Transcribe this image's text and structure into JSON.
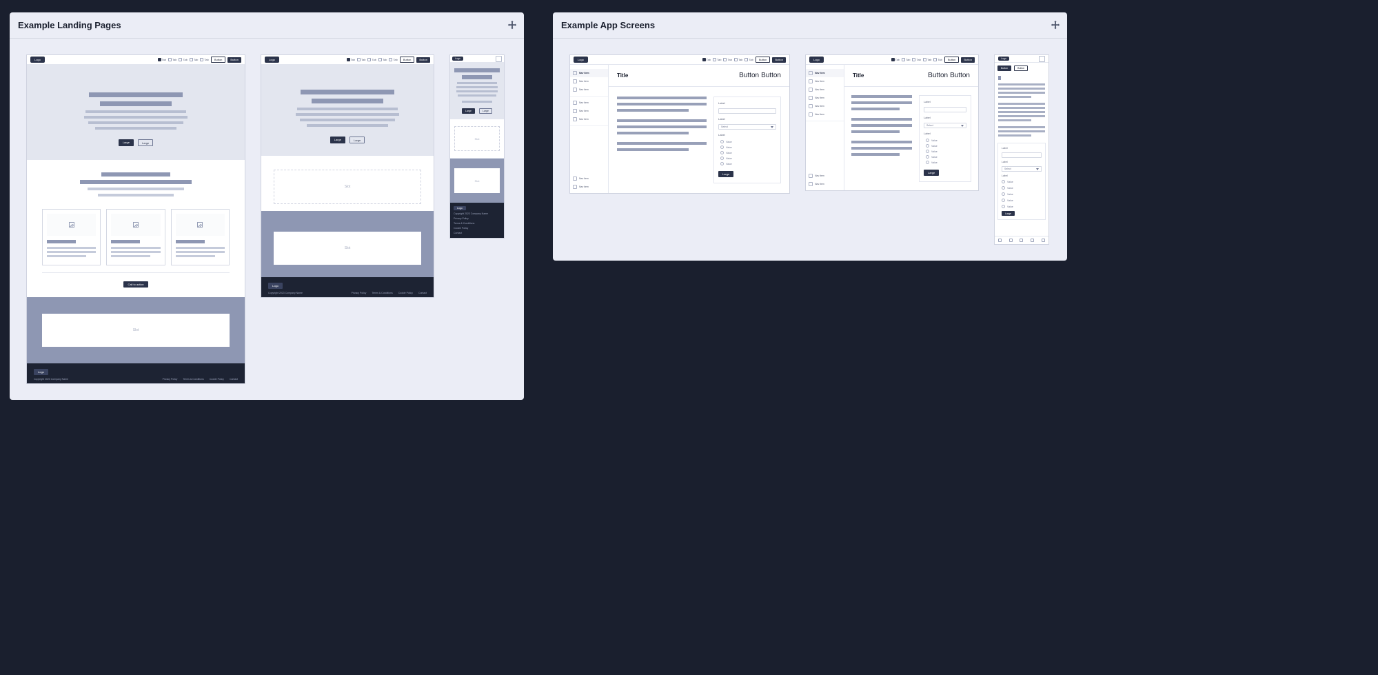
{
  "panels": {
    "landing": {
      "title": "Example Landing Pages"
    },
    "app": {
      "title": "Example App Screens"
    }
  },
  "shared": {
    "logo": "Logo",
    "tabs": [
      "Tab",
      "Tab",
      "Tab",
      "Tab",
      "Tab"
    ],
    "btn_outline": "Button",
    "btn_solid": "Button",
    "hero_btn_primary": "Large",
    "hero_btn_secondary": "Large",
    "cta": "Call to action",
    "slot": "Slot",
    "footer_copy": "Copyright 2023 Company Name",
    "footer_links": [
      "Privacy Policy",
      "Terms & Conditions",
      "Cookie Policy",
      "Contact"
    ]
  },
  "app": {
    "title": "Title",
    "title_btn_outline": "Button",
    "title_btn_solid": "Button",
    "side_items": [
      "Nav item",
      "Nav item",
      "Nav item",
      "Nav item",
      "Nav item",
      "Nav item"
    ],
    "side_bottom": [
      "Nav item",
      "Nav item"
    ],
    "form": {
      "label1": "Label",
      "label2": "Label",
      "select_value": "Select",
      "label3": "Label",
      "options": [
        "Value",
        "Value",
        "Value",
        "Value",
        "Value"
      ],
      "submit": "Large"
    }
  }
}
